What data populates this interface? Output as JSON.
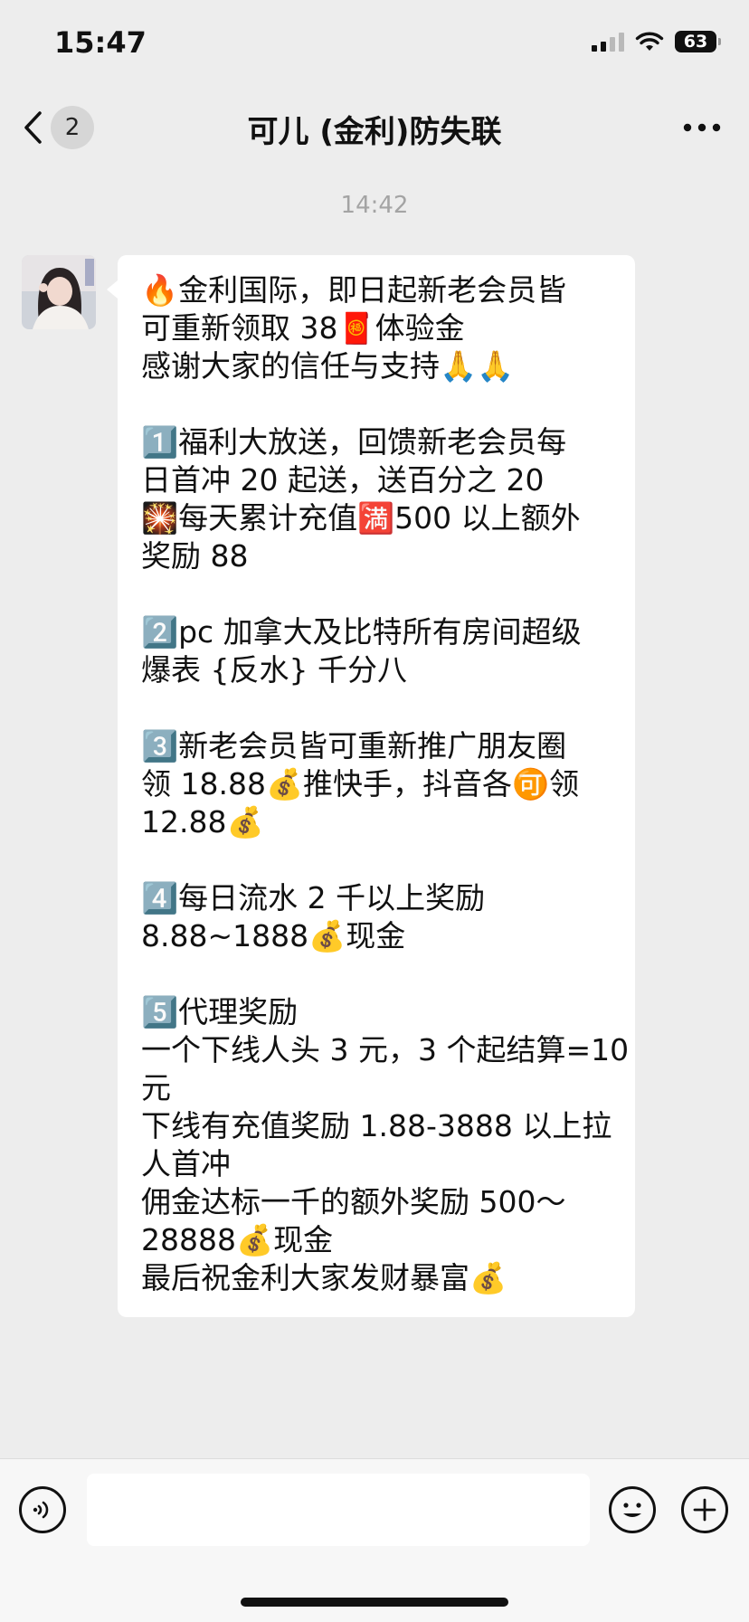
{
  "status_bar": {
    "time": "15:47",
    "battery": "63"
  },
  "nav": {
    "unread_count": "2",
    "title": "可儿 (金利)防失联"
  },
  "chat": {
    "timestamp": "14:42",
    "message_lines": [
      "🔥金利国际，即日起新老会员皆",
      "可重新领取 38🧧体验金",
      "感谢大家的信任与支持🙏🙏",
      "",
      "1️⃣福利大放送，回馈新老会员每",
      "日首冲 20 起送，送百分之 20",
      "🎇每天累计充值🈵500 以上额外",
      "奖励 88",
      "",
      "2️⃣pc 加拿大及比特所有房间超级",
      "爆表 {反水} 千分八",
      "",
      "3️⃣新老会员皆可重新推广朋友圈",
      "领 18.88💰推快手，抖音各🉑领",
      "12.88💰",
      "",
      "4️⃣每日流水 2 千以上奖励",
      "8.88~1888💰现金",
      "",
      "5️⃣代理奖励",
      "一个下线人头 3 元，3 个起结算=10",
      "元",
      "下线有充值奖励 1.88-3888 以上拉",
      "人首冲",
      "佣金达标一千的额外奖励 500～",
      "28888💰现金",
      "最后祝金利大家发财暴富💰"
    ]
  },
  "input_bar": {
    "text_value": "",
    "placeholder": ""
  },
  "icons": {
    "back": "chevron-left-icon",
    "more": "more-dots-icon",
    "voice": "voice-icon",
    "emoji": "emoji-icon",
    "plus": "plus-icon"
  }
}
